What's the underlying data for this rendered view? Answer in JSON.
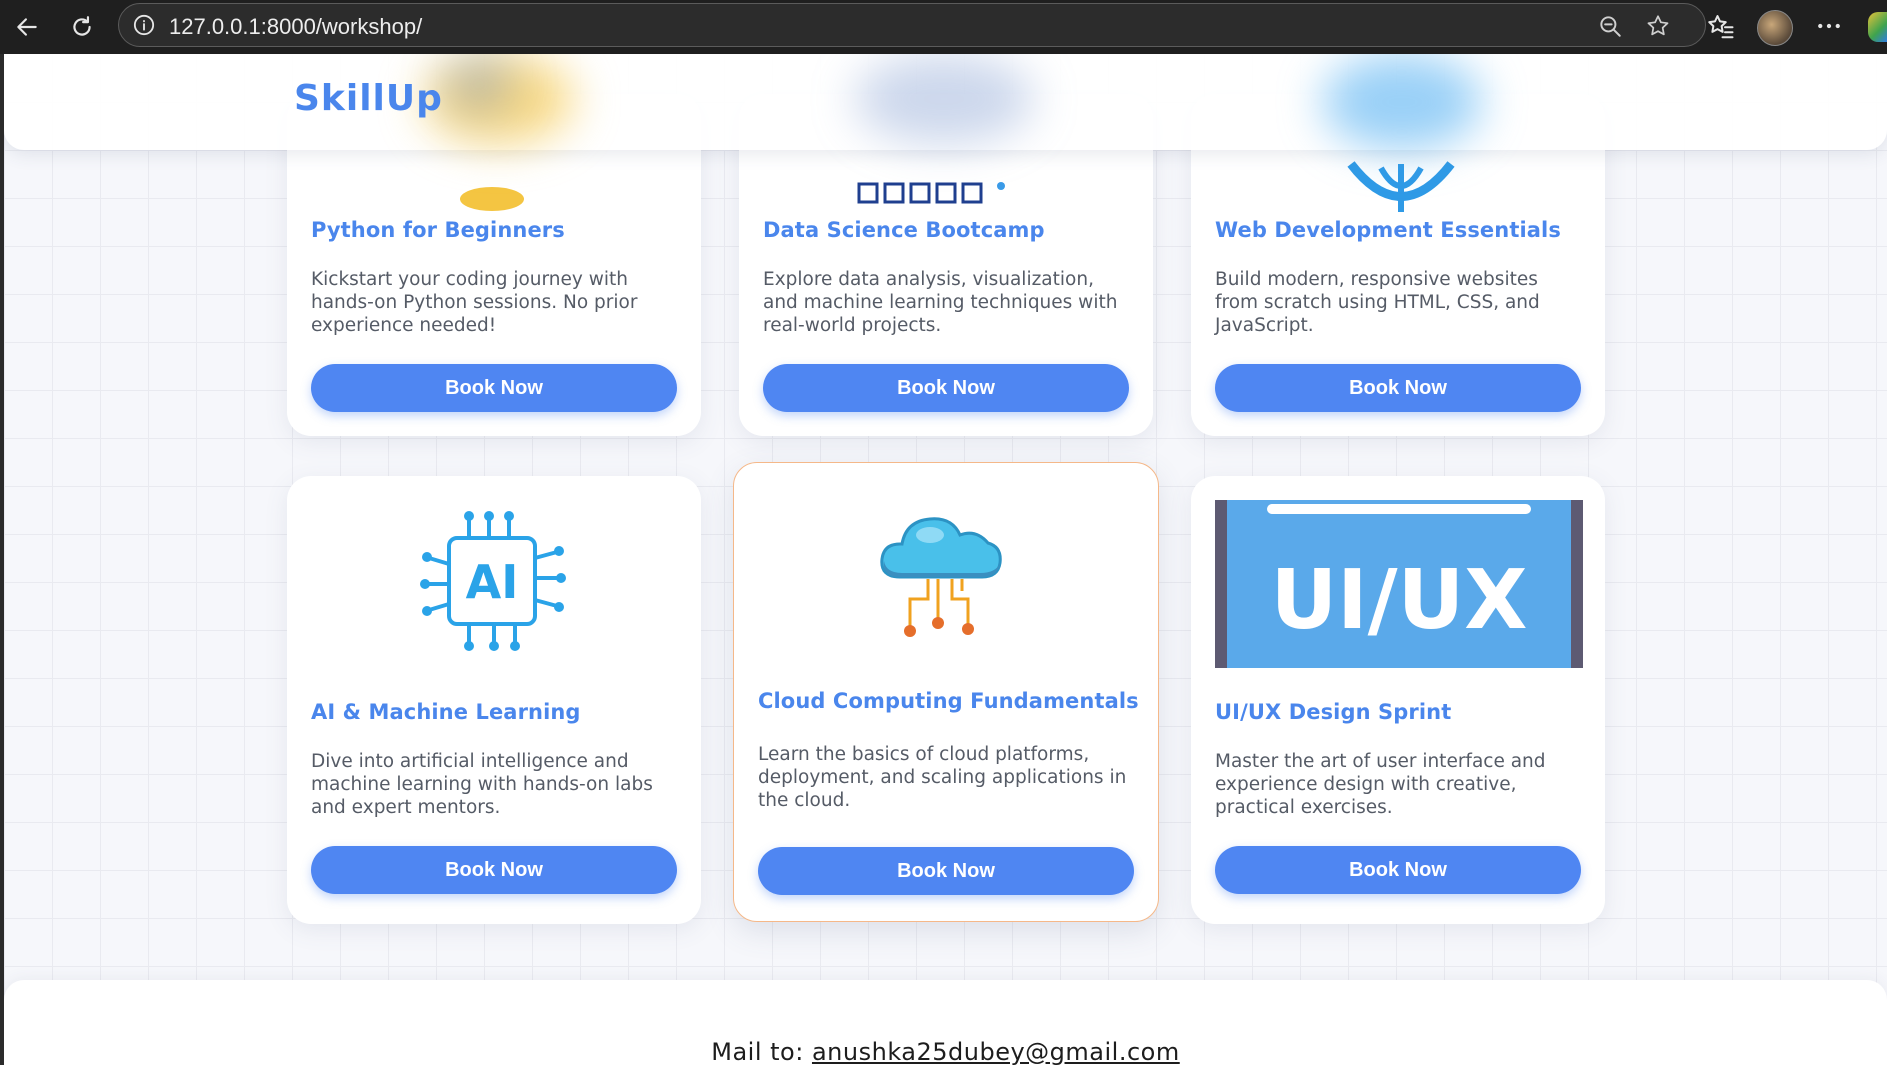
{
  "browser": {
    "url": "127.0.0.1:8000/workshop/"
  },
  "header": {
    "logo": "SkillUp"
  },
  "workshops": [
    {
      "title": "Python for Beginners",
      "description": "Kickstart your coding journey with hands-on Python sessions. No prior experience needed!",
      "button": "Book Now",
      "icon": "python-icon"
    },
    {
      "title": "Data Science Bootcamp",
      "description": "Explore data analysis, visualization, and machine learning techniques with real-world projects.",
      "button": "Book Now",
      "icon": "data-science-icon"
    },
    {
      "title": "Web Development Essentials",
      "description": "Build modern, responsive websites from scratch using HTML, CSS, and JavaScript.",
      "button": "Book Now",
      "icon": "globe-icon"
    },
    {
      "title": "AI & Machine Learning",
      "description": "Dive into artificial intelligence and machine learning with hands-on labs and expert mentors.",
      "button": "Book Now",
      "icon": "ai-chip-icon",
      "icon_text": "AI"
    },
    {
      "title": "Cloud Computing Fundamentals",
      "description": "Learn the basics of cloud platforms, deployment, and scaling applications in the cloud.",
      "button": "Book Now",
      "icon": "cloud-icon"
    },
    {
      "title": "UI/UX Design Sprint",
      "description": "Master the art of user interface and experience design with creative, practical exercises.",
      "button": "Book Now",
      "icon": "ui-ux-banner",
      "icon_text": "UI/UX"
    }
  ],
  "footer": {
    "mail_label": "Mail to:",
    "email": "anushka25dubey@gmail.com"
  },
  "colors": {
    "accent": "#4a86ec",
    "button": "#4f86f2",
    "highlight_border": "#f5b889"
  }
}
